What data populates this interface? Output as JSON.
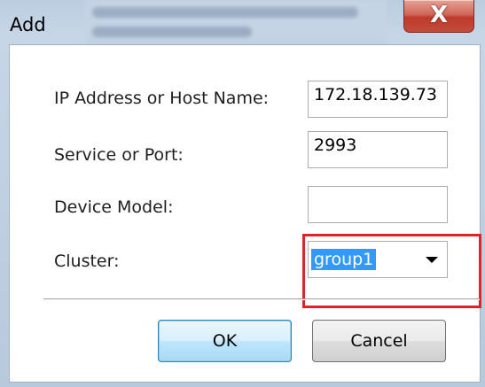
{
  "window": {
    "title": "Add",
    "close_glyph": "X"
  },
  "form": {
    "ip": {
      "label": "IP Address or Host Name:",
      "value": "172.18.139.73"
    },
    "port": {
      "label": "Service or Port:",
      "value": "2993"
    },
    "model": {
      "label": "Device Model:",
      "value": ""
    },
    "cluster": {
      "label": "Cluster:",
      "value": "group1"
    }
  },
  "buttons": {
    "ok": "OK",
    "cancel": "Cancel"
  },
  "colors": {
    "selection": "#3399ff",
    "highlight_box": "#e0232b",
    "close_button": "#c44a3a"
  }
}
